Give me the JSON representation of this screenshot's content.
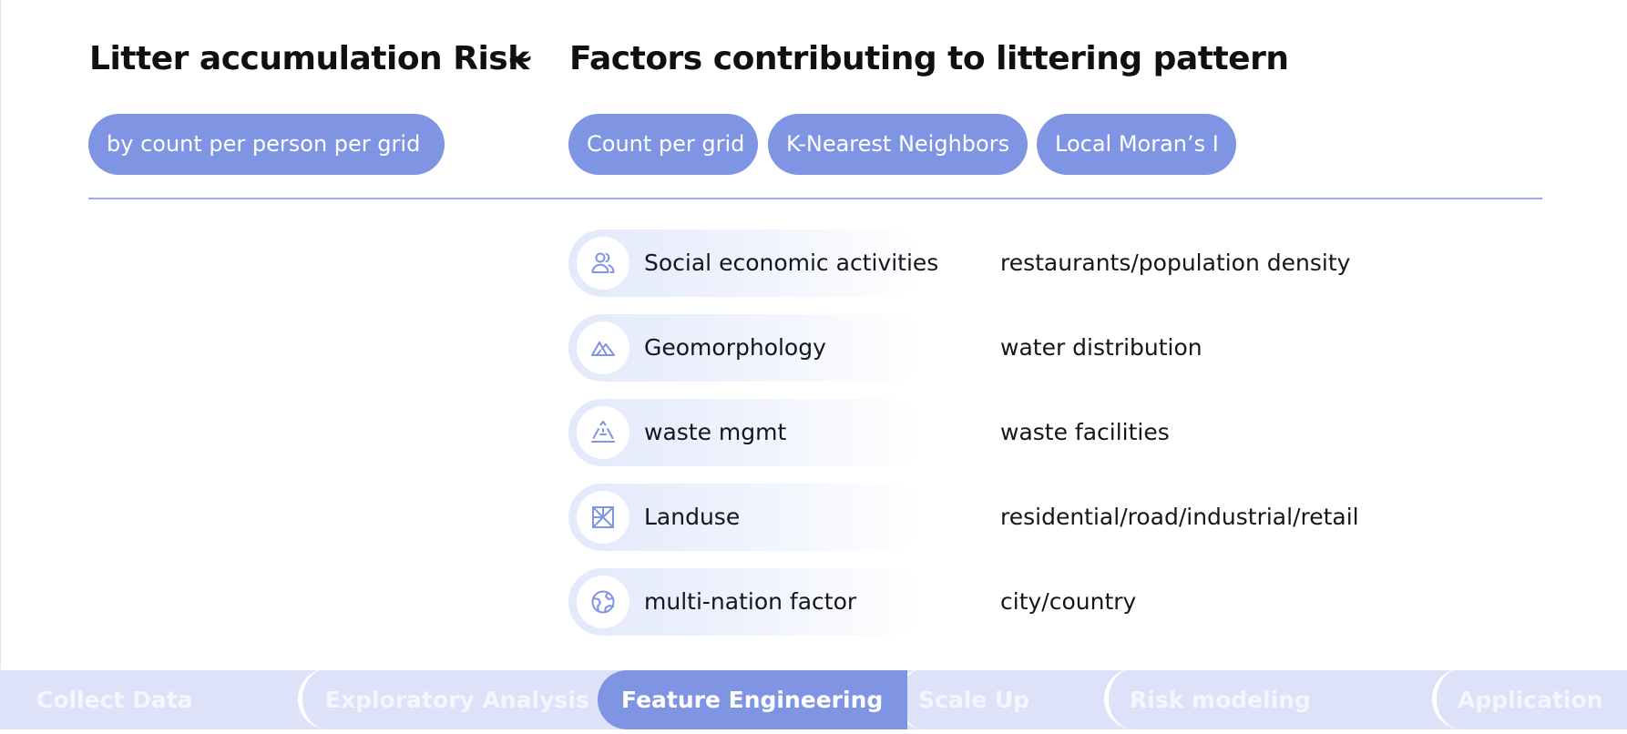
{
  "header": {
    "left_title": "Litter accumulation Risk",
    "separator": "~",
    "right_title": "Factors contributing to littering pattern"
  },
  "left_pill": "by count per person per grid",
  "method_pills": [
    "Count per grid",
    "K-Nearest Neighbors",
    "Local Moran’s I"
  ],
  "accent_color": "#7f95e4",
  "factors": [
    {
      "icon": "people-icon",
      "name": "Social economic activities",
      "detail": "restaurants/population density"
    },
    {
      "icon": "mountain-icon",
      "name": "Geomorphology",
      "detail": "water distribution"
    },
    {
      "icon": "recycle-triangle-icon",
      "name": "waste mgmt",
      "detail": "waste facilities"
    },
    {
      "icon": "land-grid-icon",
      "name": "Landuse",
      "detail": "residential/road/industrial/retail"
    },
    {
      "icon": "globe-icon",
      "name": "multi-nation factor",
      "detail": "city/country"
    }
  ],
  "nav": {
    "steps": [
      "Collect Data",
      "Exploratory Analysis",
      "Feature Engineering",
      "Scale Up",
      "Risk modeling",
      "Application"
    ],
    "active_step": "Feature Engineering"
  }
}
